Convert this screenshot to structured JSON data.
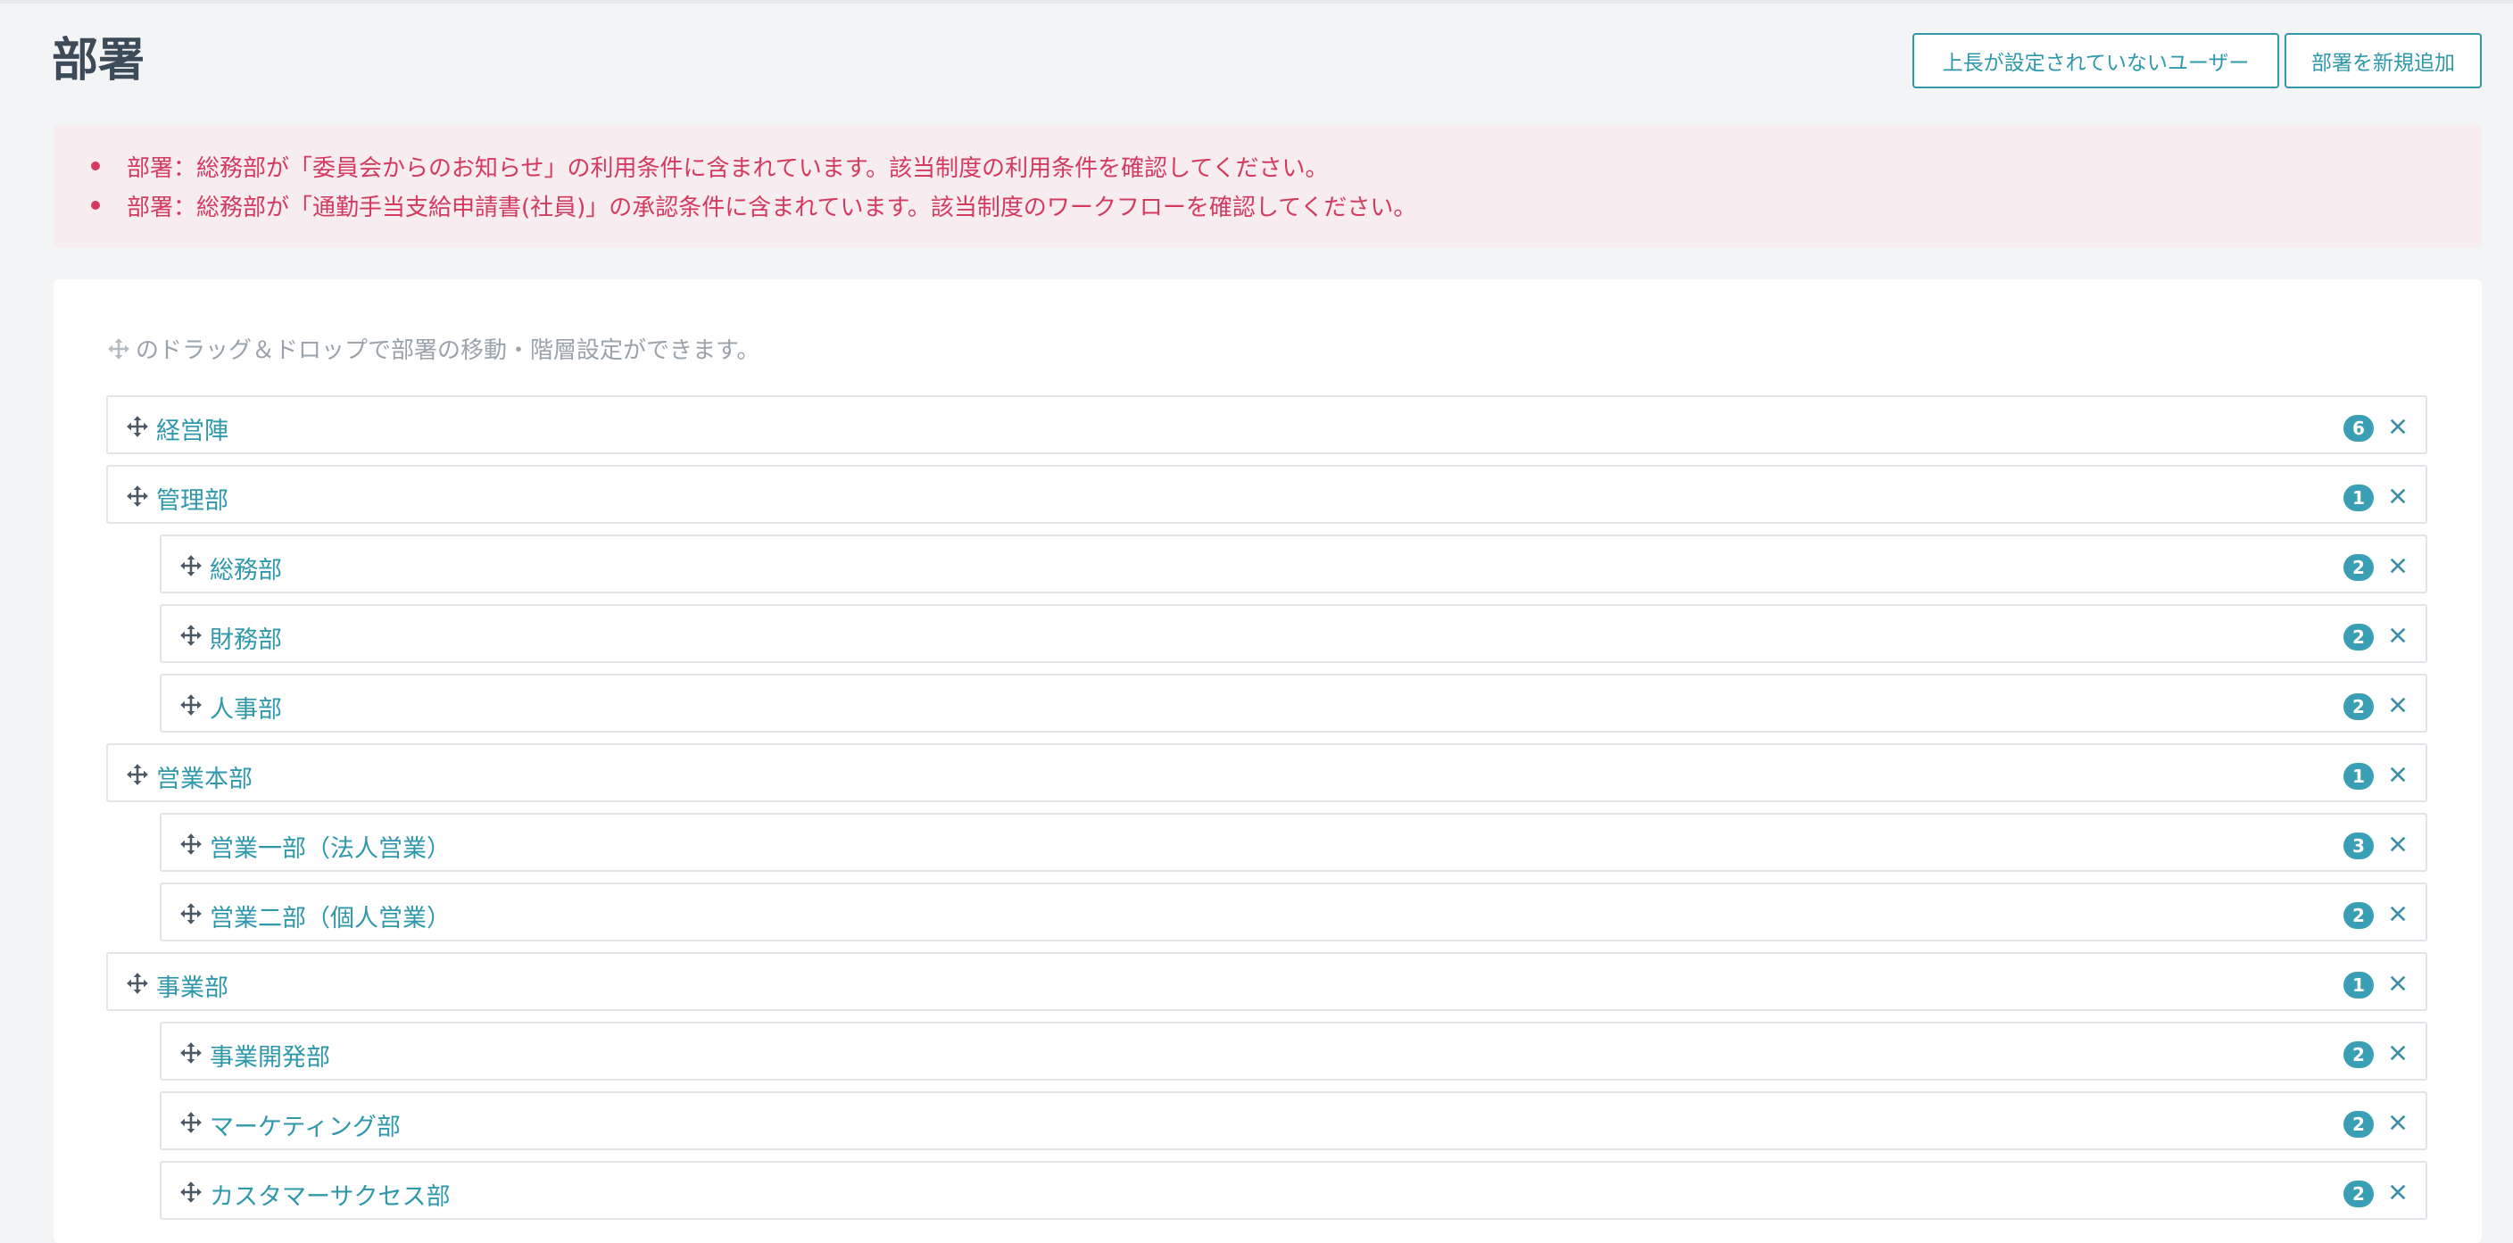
{
  "page": {
    "title": "部署"
  },
  "actions": {
    "no_supervisor_label": "上長が設定されていないユーザー",
    "add_department_label": "部署を新規追加"
  },
  "alerts": [
    "部署：総務部が「委員会からのお知らせ」の利用条件に含まれています。該当制度の利用条件を確認してください。",
    "部署：総務部が「通勤手当支給申請書(社員)」の承認条件に含まれています。該当制度のワークフローを確認してください。"
  ],
  "hint": {
    "text": "のドラッグ＆ドロップで部署の移動・階層設定ができます。",
    "icon": "move-icon"
  },
  "departments": [
    {
      "name": "経営陣",
      "count": "6",
      "level": 0
    },
    {
      "name": "管理部",
      "count": "1",
      "level": 0
    },
    {
      "name": "総務部",
      "count": "2",
      "level": 1
    },
    {
      "name": "財務部",
      "count": "2",
      "level": 1
    },
    {
      "name": "人事部",
      "count": "2",
      "level": 1
    },
    {
      "name": "営業本部",
      "count": "1",
      "level": 0
    },
    {
      "name": "営業一部（法人営業）",
      "count": "3",
      "level": 1
    },
    {
      "name": "営業二部（個人営業）",
      "count": "2",
      "level": 1
    },
    {
      "name": "事業部",
      "count": "1",
      "level": 0
    },
    {
      "name": "事業開発部",
      "count": "2",
      "level": 1
    },
    {
      "name": "マーケティング部",
      "count": "2",
      "level": 1
    },
    {
      "name": "カスタマーサクセス部",
      "count": "2",
      "level": 1
    }
  ],
  "colors": {
    "accent": "#2f98ab",
    "badge": "#3a9fb5",
    "alert_text": "#d23b5f",
    "alert_bg": "#f7ecef"
  }
}
